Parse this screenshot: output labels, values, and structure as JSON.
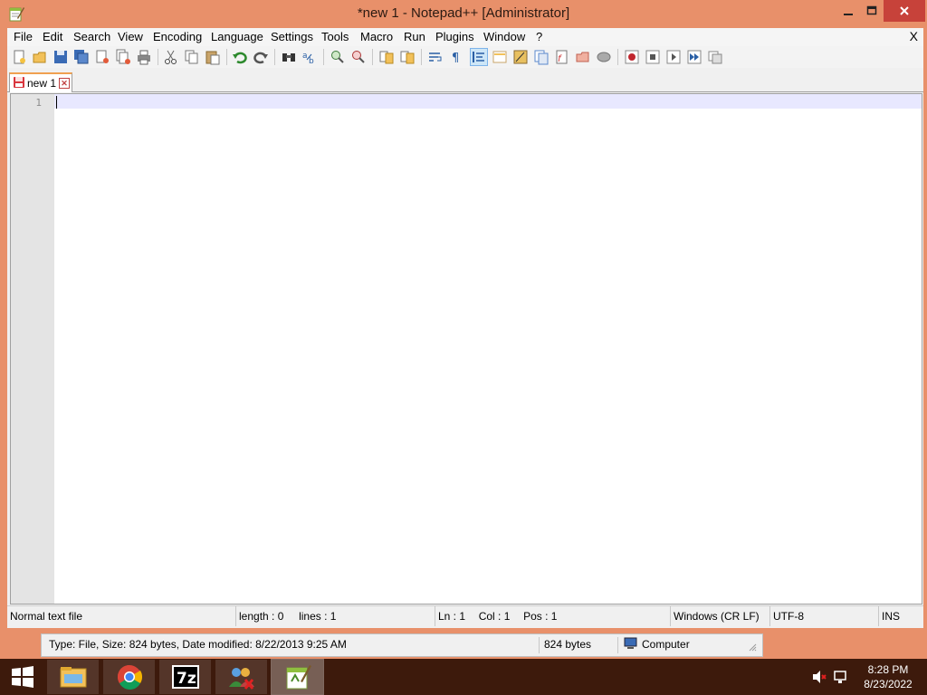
{
  "window": {
    "title": "*new 1 - Notepad++ [Administrator]",
    "accent_color": "#e8906a",
    "close_color": "#c7423a"
  },
  "menu": {
    "items": [
      "File",
      "Edit",
      "Search",
      "View",
      "Encoding",
      "Language",
      "Settings",
      "Tools",
      "Macro",
      "Run",
      "Plugins",
      "Window",
      "?"
    ],
    "close_label": "X"
  },
  "toolbar": {
    "icons": [
      "new-file-icon",
      "open-file-icon",
      "save-icon",
      "save-all-icon",
      "close-icon",
      "close-all-icon",
      "print-icon",
      "cut-icon",
      "copy-icon",
      "paste-icon",
      "undo-icon",
      "redo-icon",
      "find-icon",
      "replace-icon",
      "zoom-in-icon",
      "zoom-out-icon",
      "sync-vertical-icon",
      "sync-horizontal-icon",
      "word-wrap-icon",
      "show-all-characters-icon",
      "indent-guide-icon",
      "user-language-icon",
      "document-map-icon",
      "function-list-icon",
      "folder-as-workspace-icon",
      "monitoring-icon",
      "record-macro-icon",
      "stop-recording-icon",
      "play-macro-icon",
      "run-macro-multiple-icon",
      "save-macro-icon"
    ]
  },
  "tabs": [
    {
      "label": "new 1",
      "modified": true
    }
  ],
  "editor": {
    "line_numbers": [
      "1"
    ]
  },
  "statusbar": {
    "file_type": "Normal text file",
    "length": "length : 0",
    "lines": "lines : 1",
    "ln": "Ln : 1",
    "col": "Col : 1",
    "pos": "Pos : 1",
    "eol": "Windows (CR LF)",
    "encoding": "UTF-8",
    "mode": "INS"
  },
  "explorer_status": {
    "details": "Type: File, Size: 824 bytes, Date modified: 8/22/2013 9:25 AM",
    "size": "824 bytes",
    "location": "Computer"
  },
  "taskbar": {
    "apps": [
      "file-explorer-icon",
      "chrome-icon",
      "7zip-icon",
      "network-app-icon",
      "notepadpp-icon"
    ],
    "time": "8:28 PM",
    "date": "8/23/2022",
    "taskbar_color": "#3d1a0c"
  }
}
